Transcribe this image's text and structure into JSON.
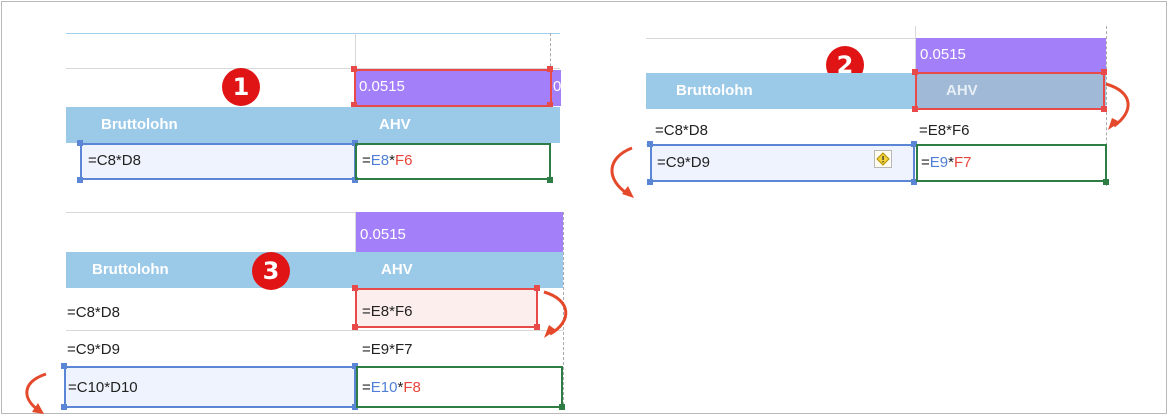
{
  "colors": {
    "purple": "#a47ffa",
    "header_blue": "#9bc9e8",
    "ref_blue": "#4f7fd6",
    "ref_red": "#e8443c",
    "badge_red": "#e01414",
    "arrow_red": "#e5492b"
  },
  "panel1": {
    "step": "1",
    "rate": "0.0515",
    "rate_clip": "0",
    "header_a": "Bruttolohn",
    "header_b": "AHV",
    "row1_a": "=C8*D8",
    "row1_b_ref1": "E8",
    "row1_b_op": "*",
    "row1_b_ref2": "F6"
  },
  "panel2": {
    "step": "2",
    "rate": "0.0515",
    "header_a": "Bruttolohn",
    "header_b": "AHV",
    "row1_a": "=C8*D8",
    "row1_b": "=E8*F6",
    "row2_a": "=C9*D9",
    "row2_b_ref1": "E9",
    "row2_b_op": "*",
    "row2_b_ref2": "F7",
    "warning_icon": "warning-diamond-icon"
  },
  "panel3": {
    "step": "3",
    "rate": "0.0515",
    "header_a": "Bruttolohn",
    "header_b": "AHV",
    "row1_a": "=C8*D8",
    "row1_b": "=E8*F6",
    "row2_a": "=C9*D9",
    "row2_b": "=E9*F7",
    "row3_a": "=C10*D10",
    "row3_b_ref1": "E10",
    "row3_b_op": "*",
    "row3_b_ref2": "F8"
  }
}
